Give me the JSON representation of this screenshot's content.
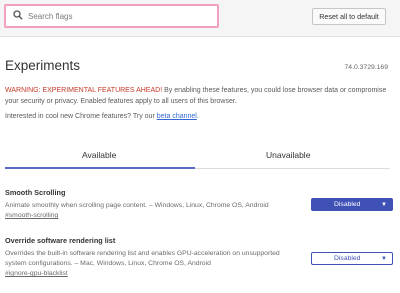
{
  "search": {
    "placeholder": "Search flags",
    "value": ""
  },
  "header": {
    "reset_label": "Reset all to default"
  },
  "page": {
    "title": "Experiments",
    "version": "74.0.3729.169",
    "warning_prefix": "WARNING: EXPERIMENTAL FEATURES AHEAD!",
    "warning_text": " By enabling these features, you could lose browser data or compromise your security or privacy. Enabled features apply to all users of this browser.",
    "interest_text": "Interested in cool new Chrome features? Try our ",
    "interest_link": "beta channel",
    "interest_end": "."
  },
  "tabs": [
    {
      "label": "Available",
      "selected": true
    },
    {
      "label": "Unavailable",
      "selected": false
    }
  ],
  "experiments": [
    {
      "name": "Smooth Scrolling",
      "description": "Animate smoothly when scrolling page content. – Windows, Linux, Chrome OS, Android",
      "link": "#smooth-scrolling",
      "value": "Disabled",
      "caret": "▼"
    },
    {
      "name": "Override software rendering list",
      "description": "Overrides the built-in software rendering list and enables GPU-acceleration on unsupported system configurations. – Mac, Windows, Linux, Chrome OS, Android",
      "link": "#ignore-gpu-blacklist",
      "value": "Disabled",
      "caret": "▼"
    }
  ],
  "colors": {
    "accent": "#3f51b5",
    "warning": "#c53929",
    "link": "#3367d6",
    "search_focus": "#f1a2c3"
  }
}
